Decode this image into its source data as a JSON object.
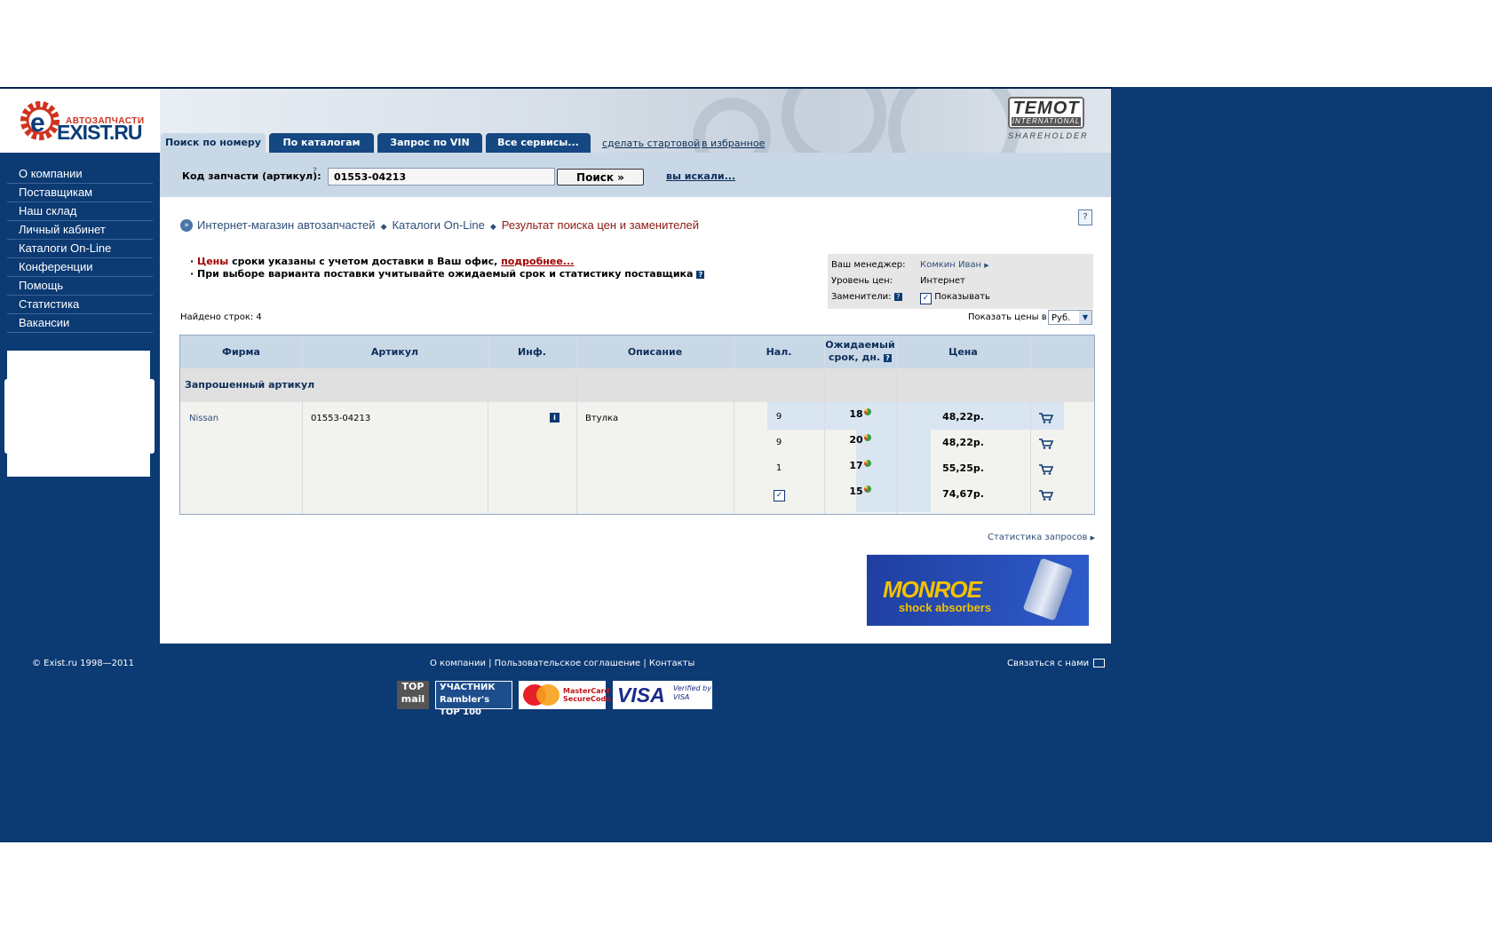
{
  "logo": {
    "name": "EXIST.RU",
    "sub": "АВТОЗАПЧАСТИ"
  },
  "partner": {
    "name": "TEMOT",
    "sub": "INTERNATIONAL",
    "role": "SHAREHOLDER"
  },
  "nav": [
    "О компании",
    "Поставщикам",
    "Наш склад",
    "Личный кабинет",
    "Каталоги On-Line",
    "Конференции",
    "Помощь",
    "Статистика",
    "Вакансии"
  ],
  "tabs": [
    "Поиск по номеру",
    "По каталогам",
    "Запрос по VIN",
    "Все сервисы..."
  ],
  "top_links": {
    "homepage": "сделать стартовой",
    "favorites": "в избранное"
  },
  "search": {
    "label": "Код запчасти (артикул):",
    "help": "?",
    "value": "01553-04213",
    "button": "Поиск »",
    "hint": "вы искали..."
  },
  "breadcrumb": {
    "items": [
      "Интернет-магазин автозапчастей",
      "Каталоги On-Line"
    ],
    "current": "Результат поиска цен и заменителей"
  },
  "notes": {
    "line1_red": "Цены",
    "line1_text": " сроки указаны с учетом доставки в Ваш офис,",
    "line1_link": "подробнее...",
    "line2": "При выборе варианта поставки учитывайте ожидаемый срок и статистику поставщика"
  },
  "manager": {
    "manager_label": "Ваш менеджер:",
    "manager_value": "Комкин Иван",
    "level_label": "Уровень цен:",
    "level_value": "Интернет",
    "subs_label": "Заменители:",
    "subs_value": "Показывать"
  },
  "found": "Найдено строк: 4",
  "price_in": {
    "label": "Показать цены в",
    "value": "Руб."
  },
  "table": {
    "headers": {
      "brand": "Фирма",
      "article": "Артикул",
      "info": "Инф.",
      "desc": "Описание",
      "stock": "Нал.",
      "days": "Ожидаемый срок, дн.",
      "price": "Цена"
    },
    "section": "Запрошенный артикул",
    "item": {
      "brand": "Nissan",
      "article": "01553-04213",
      "desc": "Втулка"
    },
    "offers": [
      {
        "stock": "9",
        "days": "18",
        "price": "48,22р."
      },
      {
        "stock": "9",
        "days": "20",
        "price": "48,22р."
      },
      {
        "stock": "1",
        "days": "17",
        "price": "55,25р."
      },
      {
        "stock": "",
        "days": "15",
        "price": "74,67р."
      }
    ]
  },
  "stats_link": "Статистика запросов",
  "banner": {
    "brand": "MONROE",
    "slogan": "shock absorbers"
  },
  "footer": {
    "copyright": "© Exist.ru 1998—2011",
    "links": "О компании | Пользовательское соглашение | Контакты",
    "contact": "Связаться с нами"
  },
  "badges": {
    "top_mail": "TOP mail",
    "rambler": "УЧАСТНИК Rambler's TOP 100",
    "mastercard": "MasterCard SecureCode.",
    "visa": "VISA",
    "verified": "Verified by VISA"
  }
}
